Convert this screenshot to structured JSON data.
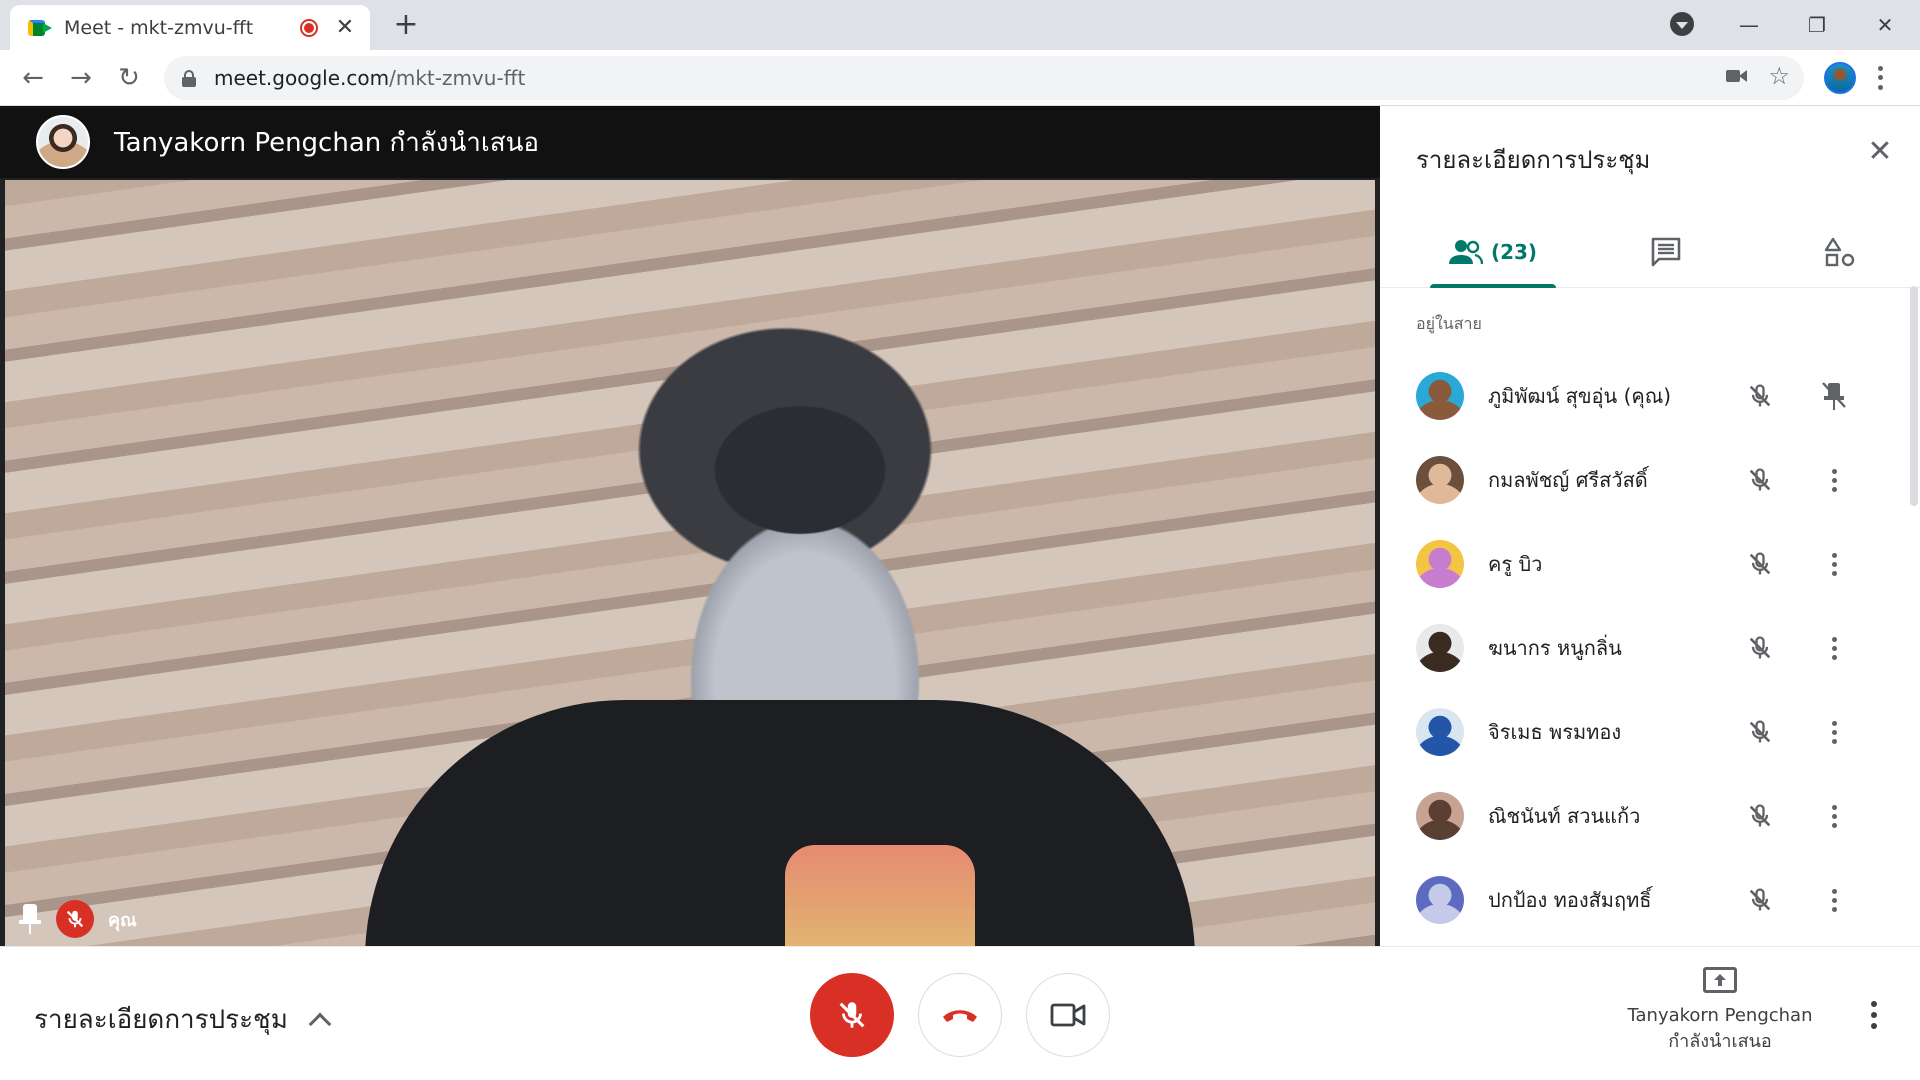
{
  "browser": {
    "tab_title": "Meet - mkt-zmvu-fft",
    "tab_close": "✕",
    "new_tab": "+",
    "url_host": "meet.google.com",
    "url_path": "/mkt-zmvu-fft",
    "back": "←",
    "forward": "→",
    "reload": "↻",
    "star": "☆",
    "minimize": "—",
    "restore": "❐",
    "close": "✕"
  },
  "presenter": {
    "title": "Tanyakorn Pengchan กำลังนำเสนอ"
  },
  "self_tile": {
    "label": "คุณ"
  },
  "panel": {
    "title": "รายละเอียดการประชุม",
    "close": "✕",
    "people_count": "(23)",
    "section_label": "อยู่ในสาย",
    "participants": [
      {
        "name": "ภูมิพัฒน์ สุขอุ่น (คุณ)",
        "avatar": [
          "#2aa9d8",
          "#8a5a3c"
        ],
        "action": "pin-off-icon"
      },
      {
        "name": "กมลพัชญ์ ศรีสวัสดิ์",
        "avatar": [
          "#6b4f3a",
          "#e0b89a"
        ],
        "action": "more-icon"
      },
      {
        "name": "ครู บิว",
        "avatar": [
          "#f4c542",
          "#c77dcf"
        ],
        "action": "more-icon"
      },
      {
        "name": "ฆนากร หนูกลิ่น",
        "avatar": [
          "#e9e9e9",
          "#3a2a22"
        ],
        "action": "more-icon"
      },
      {
        "name": "จิรเมธ พรมทอง",
        "avatar": [
          "#d8e6f0",
          "#2456a8"
        ],
        "action": "more-icon"
      },
      {
        "name": "ณิชนันท์ สวนแก้ว",
        "avatar": [
          "#c9a391",
          "#5a3f32"
        ],
        "action": "more-icon"
      },
      {
        "name": "ปกป้อง ทองสัมฤทธิ์",
        "avatar": [
          "#5c6bc0",
          "#c5cae9"
        ],
        "action": "more-icon"
      }
    ]
  },
  "bottom": {
    "details_label": "รายละเอียดการประชุม",
    "present_line1": "Tanyakorn Pengchan",
    "present_line2": "กำลังนำเสนอ"
  },
  "colors": {
    "accent": "#00796b",
    "danger": "#d93025"
  }
}
